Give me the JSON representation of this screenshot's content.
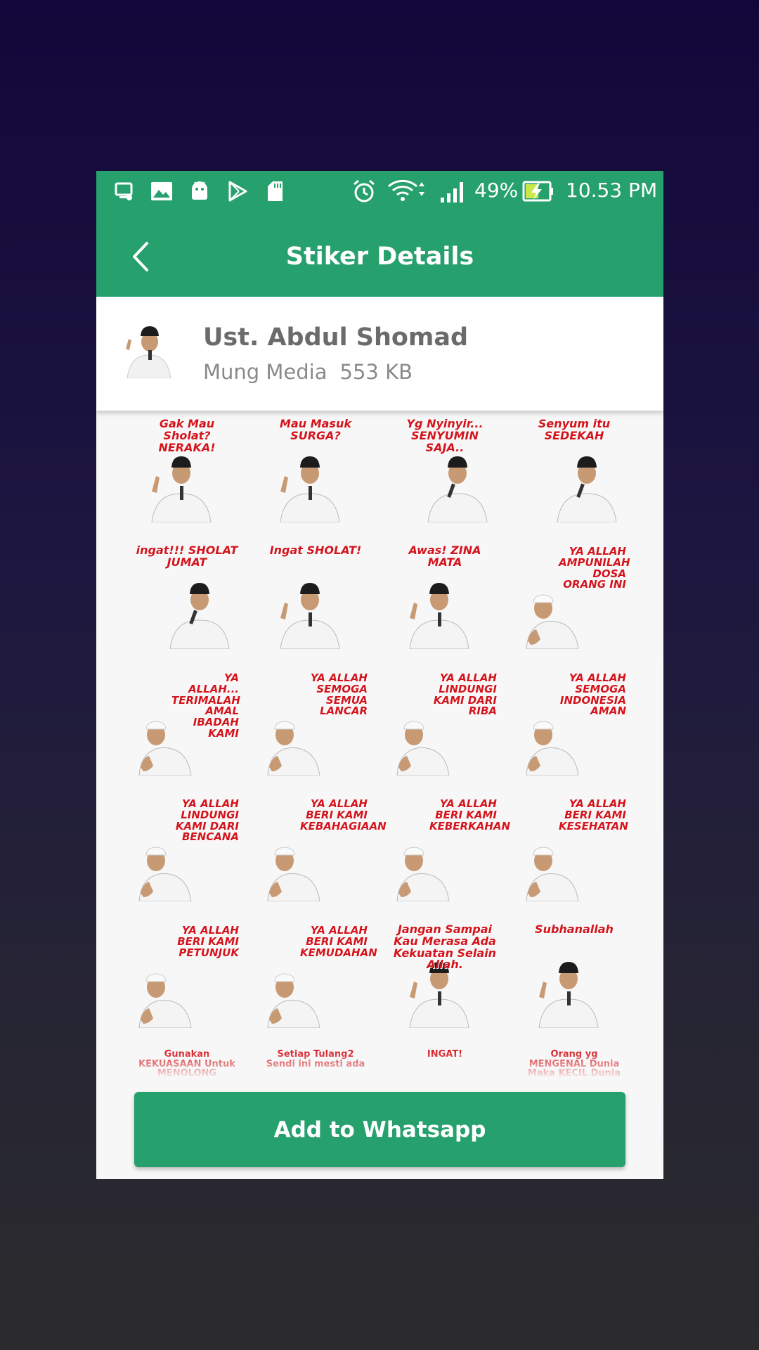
{
  "status_bar": {
    "battery": "49%",
    "time": "10.53 PM",
    "icons": [
      "screen-cast-icon",
      "gallery-icon",
      "android-icon",
      "play-store-icon",
      "sd-card-icon",
      "alarm-icon",
      "wifi-icon",
      "signal-icon",
      "battery-charging-icon"
    ]
  },
  "appbar": {
    "title": "Stiker Details",
    "back_icon": "chevron-left-icon"
  },
  "pack": {
    "name": "Ust. Abdul Shomad",
    "publisher": "Mung Media",
    "size": "553 KB"
  },
  "stickers": [
    {
      "caption": "Gak Mau Sholat? NERAKA!",
      "pose": "pointing"
    },
    {
      "caption": "Mau Masuk SURGA?",
      "pose": "pointing"
    },
    {
      "caption": "Yg Nyinyir... SENYUMIN SAJA..",
      "pose": "mic"
    },
    {
      "caption": "Senyum itu SEDEKAH",
      "pose": "mic"
    },
    {
      "caption": "ingat!!! SHOLAT JUMAT",
      "pose": "mic"
    },
    {
      "caption": "Ingat SHOLAT!",
      "pose": "pointing"
    },
    {
      "caption": "Awas! ZINA MATA",
      "pose": "pointing"
    },
    {
      "caption": "YA ALLAH AMPUNILAH DOSA ORANG INI",
      "pose": "praying"
    },
    {
      "caption": "YA ALLAH... TERIMALAH AMAL IBADAH KAMI",
      "pose": "praying"
    },
    {
      "caption": "YA ALLAH SEMOGA SEMUA LANCAR",
      "pose": "praying"
    },
    {
      "caption": "YA ALLAH LINDUNGI KAMI DARI RIBA",
      "pose": "praying"
    },
    {
      "caption": "YA ALLAH SEMOGA INDONESIA AMAN",
      "pose": "praying"
    },
    {
      "caption": "YA ALLAH LINDUNGI KAMI DARI BENCANA",
      "pose": "praying"
    },
    {
      "caption": "YA ALLAH BERI KAMI KEBAHAGIAAN",
      "pose": "praying"
    },
    {
      "caption": "YA ALLAH BERI KAMI KEBERKAHAN",
      "pose": "praying"
    },
    {
      "caption": "YA ALLAH BERI KAMI KESEHATAN",
      "pose": "praying"
    },
    {
      "caption": "YA ALLAH BERI KAMI PETUNJUK",
      "pose": "praying"
    },
    {
      "caption": "YA ALLAH BERI KAMI KEMUDAHAN",
      "pose": "praying"
    },
    {
      "caption": "Jangan Sampai Kau Merasa Ada Kekuatan Selain Allah.",
      "pose": "pointing"
    },
    {
      "caption": "Subhanallah",
      "pose": "pointing"
    },
    {
      "caption": "Gunakan KEKUASAAN Untuk MENOLONG",
      "pose": "none"
    },
    {
      "caption": "Setiap Tulang2 Sendi ini mesti ada",
      "pose": "none"
    },
    {
      "caption": "INGAT!",
      "pose": "none"
    },
    {
      "caption": "Orang yg MENGENAL Dunia Maka KECIL Dunia ini",
      "pose": "none"
    }
  ],
  "add_button": {
    "label": "Add to Whatsapp"
  },
  "colors": {
    "primary": "#26a06c",
    "caption_red": "#d4141c"
  }
}
